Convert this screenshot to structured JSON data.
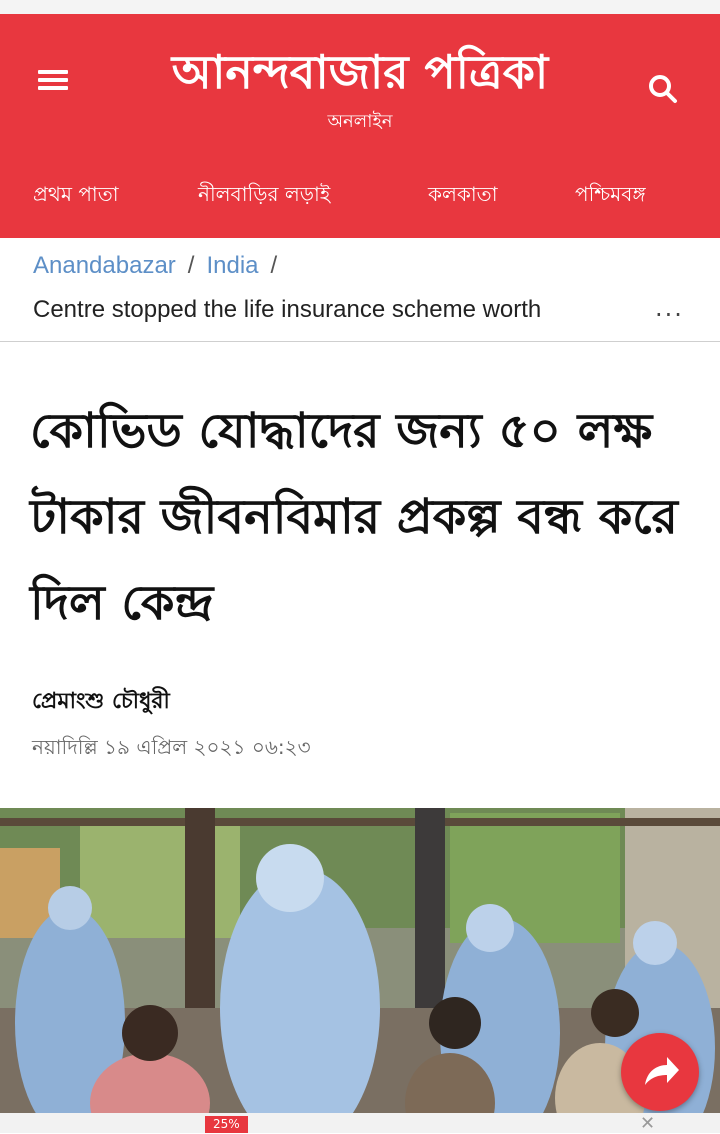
{
  "header": {
    "logo_text": "আনন্দবাজার পত্রিকা",
    "logo_subtitle": "অনলাইন",
    "nav_items": [
      "প্রথম পাতা",
      "নীলবাড়ির লড়াই",
      "কলকাতা",
      "পশ্চিমবঙ্গ"
    ],
    "menu_icon": "hamburger-icon",
    "search_icon": "search-icon",
    "brand_color": "#e8373f"
  },
  "breadcrumb": {
    "home": "Anandabazar",
    "section": "India",
    "separator": "/",
    "current": "Centre stopped the life insurance scheme worth",
    "more_label": "..."
  },
  "article": {
    "headline": "কোভিড যোদ্ধাদের জন্য ৫০ লক্ষ টাকার জীবনবিমার প্রকল্প বন্ধ করে দিল কেন্দ্র",
    "author": "প্রেমাংশু চৌধুরী",
    "dateline": "নয়াদিল্লি ১৯ এপ্রিল ২০২১ ০৬:২৩"
  },
  "share_button": {
    "icon": "share-arrow-icon"
  },
  "ad": {
    "badge": "25%",
    "close_icon": "close-icon"
  }
}
